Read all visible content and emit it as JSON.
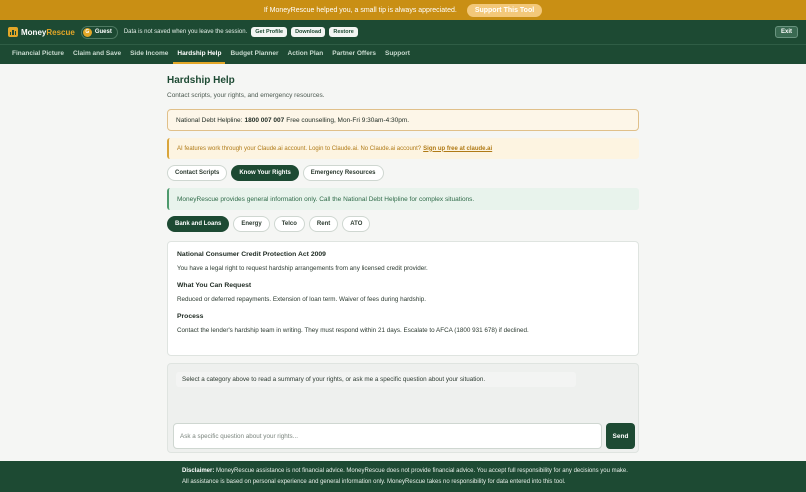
{
  "tipbar": {
    "text": "If MoneyRescue helped you, a small tip is always appreciated.",
    "button": "Support This Tool"
  },
  "header": {
    "logo_part1": "Money",
    "logo_part2": "Rescue",
    "guest_initial": "G",
    "guest_label": "Guest",
    "session_note": "Data is not saved when you leave the session.",
    "buttons": [
      "Get Profile",
      "Download",
      "Restore"
    ],
    "exit": "Exit"
  },
  "nav": {
    "items": [
      "Financial Picture",
      "Claim and Save",
      "Side Income",
      "Hardship Help",
      "Budget Planner",
      "Action Plan",
      "Partner Offers",
      "Support"
    ],
    "active_index": 3
  },
  "page": {
    "title": "Hardship Help",
    "subtitle": "Contact scripts, your rights, and emergency resources."
  },
  "helpline": {
    "label": "National Debt Helpline:",
    "number": "1800 007 007",
    "hours": "Free counselling, Mon-Fri 9:30am-4:30pm."
  },
  "ai_note": {
    "text": "AI features work through your Claude.ai account. Login to Claude.ai. No Claude.ai account?",
    "link": "Sign up free at claude.ai"
  },
  "tabs": {
    "items": [
      "Contact Scripts",
      "Know Your Rights",
      "Emergency Resources"
    ],
    "active_index": 1
  },
  "info_note": "MoneyRescue provides general information only. Call the National Debt Helpline for complex situations.",
  "categories": {
    "items": [
      "Bank and Loans",
      "Energy",
      "Telco",
      "Rent",
      "ATO"
    ],
    "active_index": 0
  },
  "rights_card": {
    "act_title": "National Consumer Credit Protection Act 2009",
    "act_text": "You have a legal right to request hardship arrangements from any licensed credit provider.",
    "request_title": "What You Can Request",
    "request_text": "Reduced or deferred repayments. Extension of loan term. Waiver of fees during hardship.",
    "process_title": "Process",
    "process_text": "Contact the lender's hardship team in writing. They must respond within 21 days. Escalate to AFCA (1800 931 678) if declined."
  },
  "chat": {
    "message": "Select a category above to read a summary of your rights, or ask me a specific question about your situation.",
    "placeholder": "Ask a specific question about your rights...",
    "send": "Send"
  },
  "footer": {
    "label": "Disclaimer:",
    "text": "MoneyRescue assistance is not financial advice. MoneyRescue does not provide financial advice. You accept full responsibility for any decisions you make. All assistance is based on personal experience and general information only. MoneyRescue takes no responsibility for data entered into this tool."
  },
  "colors": {
    "brand_green": "#1d4a33",
    "accent_gold": "#e3a728",
    "tip_bar": "#c98f14"
  }
}
